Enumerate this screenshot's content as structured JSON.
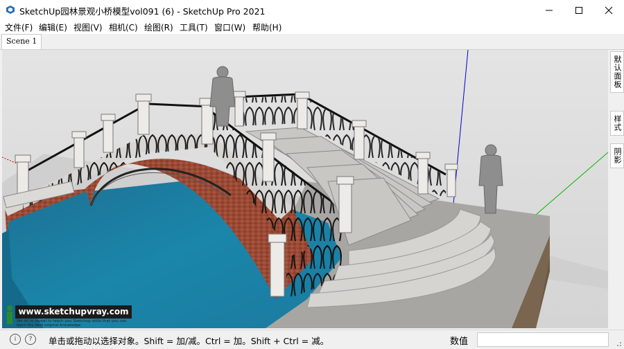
{
  "window": {
    "title": "SketchUp园林景观小桥模型vol091 (6) - SketchUp Pro 2021",
    "icon": "sketchup-logo-icon",
    "controls": [
      "minimize-icon",
      "maximize-icon",
      "close-icon"
    ]
  },
  "menu": {
    "items": [
      "文件(F)",
      "编辑(E)",
      "视图(V)",
      "相机(C)",
      "绘图(R)",
      "工具(T)",
      "窗口(W)",
      "帮助(H)"
    ]
  },
  "scenes": {
    "tabs": [
      "Scene 1"
    ],
    "active": 0
  },
  "viewport": {
    "sky_color": "#dcdcdc",
    "water_color": "#1a7ea0",
    "brick_color": "#9a4a35",
    "ground_color": "#a8a6a2",
    "axis_colors": {
      "green": "#00b400",
      "blue": "#0000c8",
      "red": "#c80000"
    }
  },
  "watermark": {
    "url": "www.sketchupvray.com",
    "subtext": "We do to reveal to teach you Sketchup skills that you can learn the best original knowledge."
  },
  "right_panel": {
    "tabs": [
      "默认面板",
      "样式",
      "阴影"
    ]
  },
  "status": {
    "icons": [
      "info-circle-icon",
      "help-circle-icon"
    ],
    "message": "单击或拖动以选择对象。Shift = 加/减。Ctrl = 加。Shift + Ctrl = 减。",
    "measurements_label": "数值",
    "measurements_value": ""
  }
}
